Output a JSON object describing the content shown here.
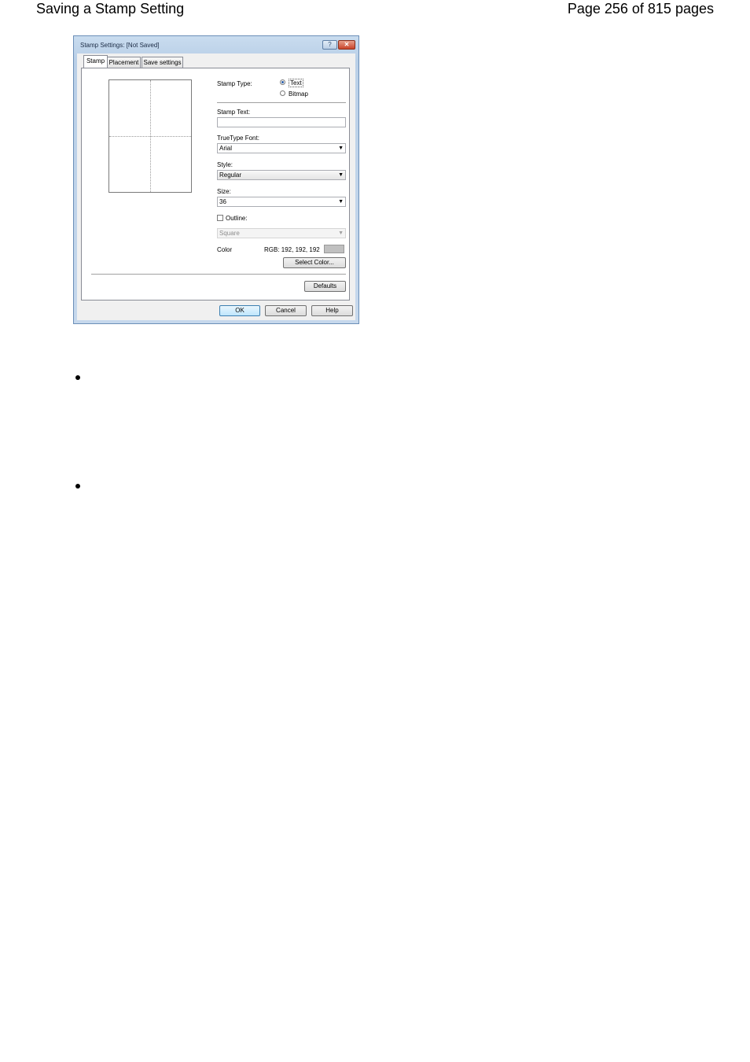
{
  "page": {
    "title": "Saving a Stamp Setting",
    "page_number": "Page 256 of 815 pages"
  },
  "dialog": {
    "title": "Stamp Settings: [Not Saved]",
    "help_glyph": "?",
    "close_glyph": "✕",
    "tabs": [
      {
        "label": "Stamp"
      },
      {
        "label": "Placement"
      },
      {
        "label": "Save settings"
      }
    ],
    "stamp_type_label": "Stamp Type:",
    "stamp_type_options": [
      {
        "label": "Text",
        "selected": true
      },
      {
        "label": "Bitmap",
        "selected": false
      }
    ],
    "stamp_text_label": "Stamp Text:",
    "stamp_text_value": "",
    "font_label": "TrueType Font:",
    "font_value": "Arial",
    "style_label": "Style:",
    "style_value": "Regular",
    "size_label": "Size:",
    "size_value": "36",
    "outline_label": "Outline:",
    "outline_checked": false,
    "outline_value": "Square",
    "color_label": "Color",
    "rgb_text": "RGB: 192, 192, 192",
    "color_swatch": "#c0c0c0",
    "select_color_button": "Select Color...",
    "defaults_button": "Defaults",
    "ok_button": "OK",
    "cancel_button": "Cancel",
    "help_button": "Help",
    "dropdown_glyph": "▼"
  },
  "bullets": 2
}
